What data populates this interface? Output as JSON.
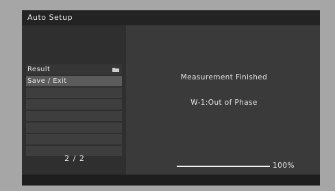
{
  "window": {
    "title": "Auto Setup"
  },
  "menu": {
    "items": [
      {
        "label": "Result",
        "icon": "folder-icon"
      },
      {
        "label": "Save / Exit"
      },
      {
        "label": ""
      },
      {
        "label": ""
      },
      {
        "label": ""
      },
      {
        "label": ""
      },
      {
        "label": ""
      },
      {
        "label": ""
      }
    ],
    "page_indicator": "2 / 2"
  },
  "status": {
    "message": "Measurement Finished",
    "detail": "W-1:Out of Phase"
  },
  "progress": {
    "percent": 100,
    "label": "100%"
  }
}
